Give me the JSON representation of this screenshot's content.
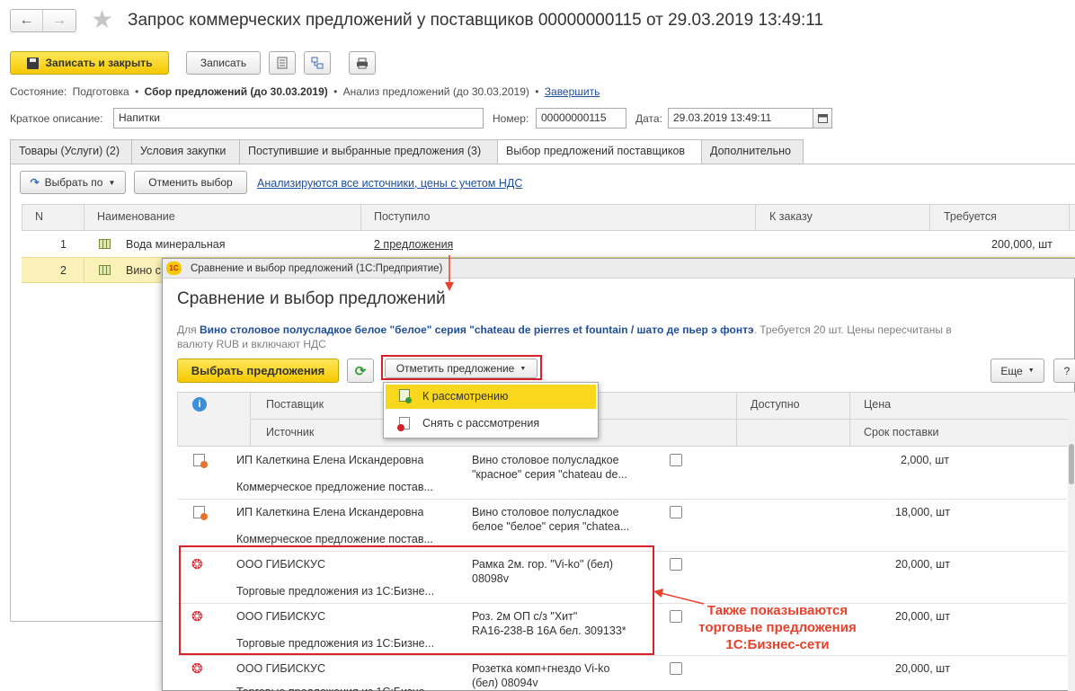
{
  "header": {
    "title": "Запрос коммерческих предложений у поставщиков 00000000115 от 29.03.2019 13:49:11"
  },
  "toolbar": {
    "save_close": "Записать и закрыть",
    "save": "Записать"
  },
  "status": {
    "label": "Состояние:",
    "step1": "Подготовка",
    "step2": "Сбор предложений (до 30.03.2019)",
    "step3": "Анализ предложений (до 30.03.2019)",
    "finish": "Завершить",
    "bullet": "•"
  },
  "form": {
    "desc_label": "Краткое описание:",
    "desc_value": "Напитки",
    "num_label": "Номер:",
    "num_value": "00000000115",
    "date_label": "Дата:",
    "date_value": "29.03.2019 13:49:11"
  },
  "tabs": [
    {
      "label": "Товары (Услуги) (2)"
    },
    {
      "label": "Условия закупки"
    },
    {
      "label": "Поступившие и выбранные предложения (3)"
    },
    {
      "label": "Выбор предложений поставщиков"
    },
    {
      "label": "Дополнительно"
    }
  ],
  "tab_toolbar": {
    "select_by": "Выбрать по",
    "cancel_select": "Отменить выбор",
    "analysis_link": "Анализируются все источники, цены с учетом НДС"
  },
  "main_table": {
    "columns": [
      "N",
      "Наименование",
      "Поступило",
      "К заказу",
      "Требуется"
    ],
    "rows": [
      {
        "n": "1",
        "name": "Вода минеральная",
        "received": "2 предложения",
        "to_order": "",
        "required": "200,000, шт"
      },
      {
        "n": "2",
        "name": "Вино с",
        "received": "",
        "to_order": "",
        "required": ""
      }
    ]
  },
  "dialog": {
    "window_title": "Сравнение и выбор предложений  (1С:Предприятие)",
    "app_badge": "1С",
    "heading": "Сравнение и выбор предложений",
    "desc_prefix": "Для",
    "desc_item": "Вино столовое полусладкое белое \"белое\" серия \"chateau de pierres et fountain / шато де пьер э фонтэ",
    "desc_suffix_line1": ". Требуется 20 шт. Цены пересчитаны в",
    "desc_line2": "валюту RUB и включают НДС",
    "btn_select": "Выбрать предложения",
    "btn_mark": "Отметить предложение",
    "btn_more": "Еще",
    "btn_help": "?",
    "menu": [
      {
        "label": "К рассмотрению"
      },
      {
        "label": "Снять с рассмотрения"
      }
    ],
    "columns": {
      "supplier": "Поставщик",
      "source": "Источник",
      "available": "Доступно",
      "price": "Цена",
      "delivery": "Срок поставки"
    },
    "rows": [
      {
        "supplier": "ИП Калеткина Елена Искандеровна",
        "source": "Коммерческое предложение постав...",
        "product1": "Вино столовое полусладкое",
        "product2": "\"красное\" серия \"chateau de...",
        "qty": "2,000, шт"
      },
      {
        "supplier": "ИП Калеткина Елена Искандеровна",
        "source": "Коммерческое предложение постав...",
        "product1": "Вино столовое полусладкое",
        "product2": "белое \"белое\" серия \"chatea...",
        "qty": "18,000, шт"
      },
      {
        "supplier": "ООО ГИБИСКУС",
        "source": "Торговые предложения из 1С:Бизне...",
        "product1": "Рамка 2м. гор. \"Vi-ko\" (бел)",
        "product2": "08098v",
        "qty": "20,000, шт"
      },
      {
        "supplier": "ООО ГИБИСКУС",
        "source": "Торговые предложения из 1С:Бизне...",
        "product1": "Роз. 2м ОП с/з \"Хит\"",
        "product2": "RA16-238-B 16A бел. 309133*",
        "qty": "20,000, шт"
      },
      {
        "supplier": "ООО ГИБИСКУС",
        "source": "Торговые предложения из 1С:Бизне...",
        "product1": "Розетка комп+гнездо Vi-ko",
        "product2": "(бел) 08094v",
        "qty": "20,000, шт"
      }
    ]
  },
  "annotation": {
    "line1": "Также показываются",
    "line2": "торговые предложения",
    "line3": "1С:Бизнес-сети",
    "color": "#e8412c"
  }
}
